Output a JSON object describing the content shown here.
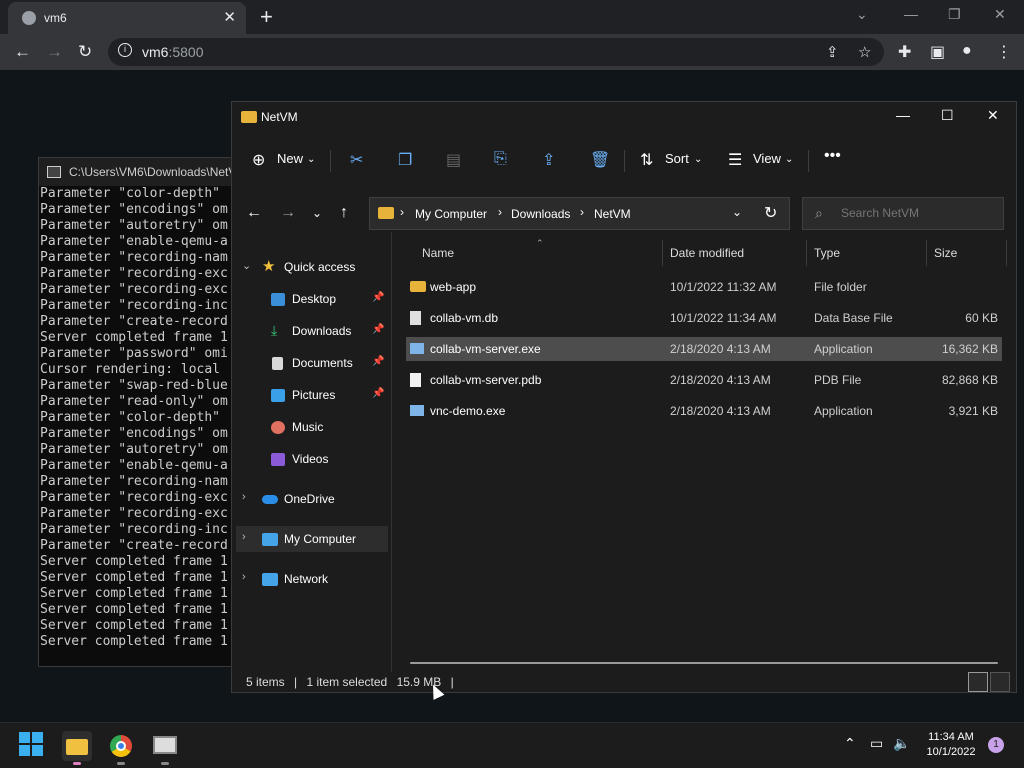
{
  "browser": {
    "tab_title": "vm6",
    "url_host": "vm6",
    "url_port": ":5800"
  },
  "console": {
    "title": "C:\\Users\\VM6\\Downloads\\NetV",
    "lines": [
      "Parameter \"color-depth\"",
      "Parameter \"encodings\" om",
      "Parameter \"autoretry\" om",
      "Parameter \"enable-qemu-a",
      "Parameter \"recording-nam",
      "Parameter \"recording-exc",
      "Parameter \"recording-exc",
      "Parameter \"recording-inc",
      "Parameter \"create-record",
      "Server completed frame 1",
      "Parameter \"password\" omi",
      "Cursor rendering: local",
      "Parameter \"swap-red-blue",
      "Parameter \"read-only\" om",
      "Parameter \"color-depth\"",
      "Parameter \"encodings\" om",
      "Parameter \"autoretry\" om",
      "Parameter \"enable-qemu-a",
      "Parameter \"recording-nam",
      "Parameter \"recording-exc",
      "Parameter \"recording-exc",
      "Parameter \"recording-inc",
      "Parameter \"create-record",
      "Server completed frame 1",
      "Server completed frame 1",
      "Server completed frame 1",
      "Server completed frame 1",
      "Server completed frame 1",
      "Server completed frame 1"
    ]
  },
  "explorer": {
    "title": "NetVM",
    "commands": {
      "new": "New",
      "sort": "Sort",
      "view": "View"
    },
    "breadcrumb": [
      "My Computer",
      "Downloads",
      "NetVM"
    ],
    "search_placeholder": "Search NetVM",
    "nav": {
      "quick_access": "Quick access",
      "desktop": "Desktop",
      "downloads": "Downloads",
      "documents": "Documents",
      "pictures": "Pictures",
      "music": "Music",
      "videos": "Videos",
      "onedrive": "OneDrive",
      "my_computer": "My Computer",
      "network": "Network"
    },
    "columns": {
      "name": "Name",
      "date": "Date modified",
      "type": "Type",
      "size": "Size"
    },
    "files": [
      {
        "name": "web-app",
        "date": "10/1/2022 11:32 AM",
        "type": "File folder",
        "size": ""
      },
      {
        "name": "collab-vm.db",
        "date": "10/1/2022 11:34 AM",
        "type": "Data Base File",
        "size": "60 KB"
      },
      {
        "name": "collab-vm-server.exe",
        "date": "2/18/2020 4:13 AM",
        "type": "Application",
        "size": "16,362 KB"
      },
      {
        "name": "collab-vm-server.pdb",
        "date": "2/18/2020 4:13 AM",
        "type": "PDB File",
        "size": "82,868 KB"
      },
      {
        "name": "vnc-demo.exe",
        "date": "2/18/2020 4:13 AM",
        "type": "Application",
        "size": "3,921 KB"
      }
    ],
    "status": {
      "items": "5 items",
      "selected": "1 item selected",
      "size": "15.9 MB"
    }
  },
  "taskbar": {
    "time": "11:34 AM",
    "date": "10/1/2022",
    "notifications": "1"
  }
}
